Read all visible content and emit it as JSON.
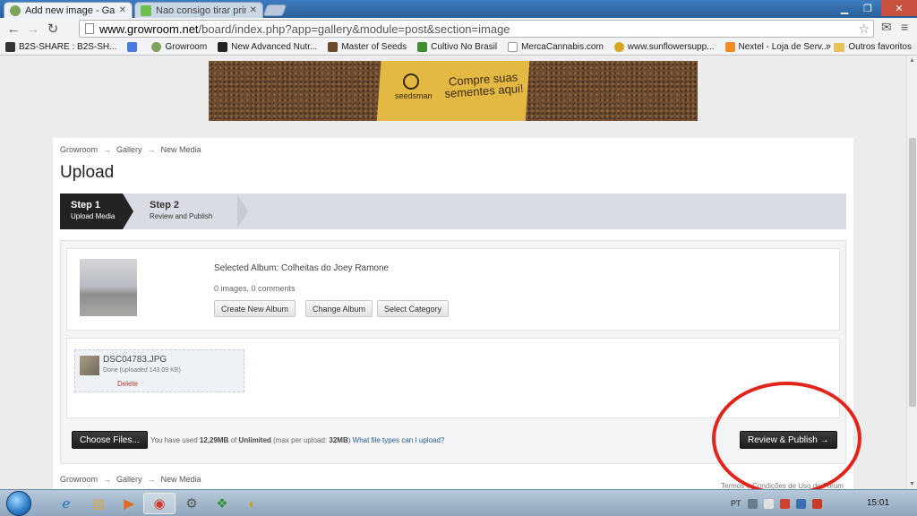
{
  "browser": {
    "tabs": [
      {
        "title": "Add new image - Gallery",
        "active": true
      },
      {
        "title": "Nao consigo tirar print sc",
        "active": false
      }
    ],
    "url_host": "www.growroom.net",
    "url_path": "/board/index.php?app=gallery&module=post&section=image",
    "bookmarks": [
      "B2S-SHARE : B2S-SH...",
      "Growroom",
      "New Advanced Nutr...",
      "Master of Seeds",
      "Cultivo No Brasil",
      "MercaCannabis.com",
      "www.sunflowersupp...",
      "Nextel - Loja de Serv..."
    ],
    "bookmarks_overflow": "»",
    "other_bookmarks": "Outros favoritos"
  },
  "banner": {
    "brand": "seedsman",
    "slogan": "Compre suas sementes aqui!"
  },
  "page": {
    "breadcrumb": [
      "Growroom",
      "Gallery",
      "New Media"
    ],
    "breadcrumb_sep": "→",
    "title": "Upload",
    "steps": [
      {
        "title": "Step 1",
        "subtitle": "Upload Media",
        "active": true
      },
      {
        "title": "Step 2",
        "subtitle": "Review and Publish",
        "active": false
      }
    ],
    "album": {
      "selected_label": "Selected Album: Colheitas do Joey Ramone",
      "stats": "0 images, 0 comments",
      "buttons": [
        "Create New Album",
        "Change Album",
        "Select Category"
      ]
    },
    "file": {
      "name": "DSC04783.JPG",
      "status": "Done (uploaded 143.09 KB)",
      "delete": "Delete"
    },
    "actions": {
      "choose_files": "Choose Files...",
      "usage_prefix": "You have used ",
      "usage_used": "12,29MB",
      "usage_of": " of ",
      "usage_limit": "Unlimited",
      "usage_max": " (max per upload: ",
      "usage_max_value": "32MB",
      "usage_close": ")",
      "file_types_link": "What file types can I upload?",
      "review_publish": "Review & Publish →"
    },
    "terms": "Termos e Condições de Uso do Fórum"
  },
  "taskbar": {
    "language": "PT",
    "clock": "15:01"
  },
  "colors": {
    "annotation_circle": "#e2241a",
    "dark_button": "#222222",
    "chrome_blue": "#2f6fb0"
  }
}
